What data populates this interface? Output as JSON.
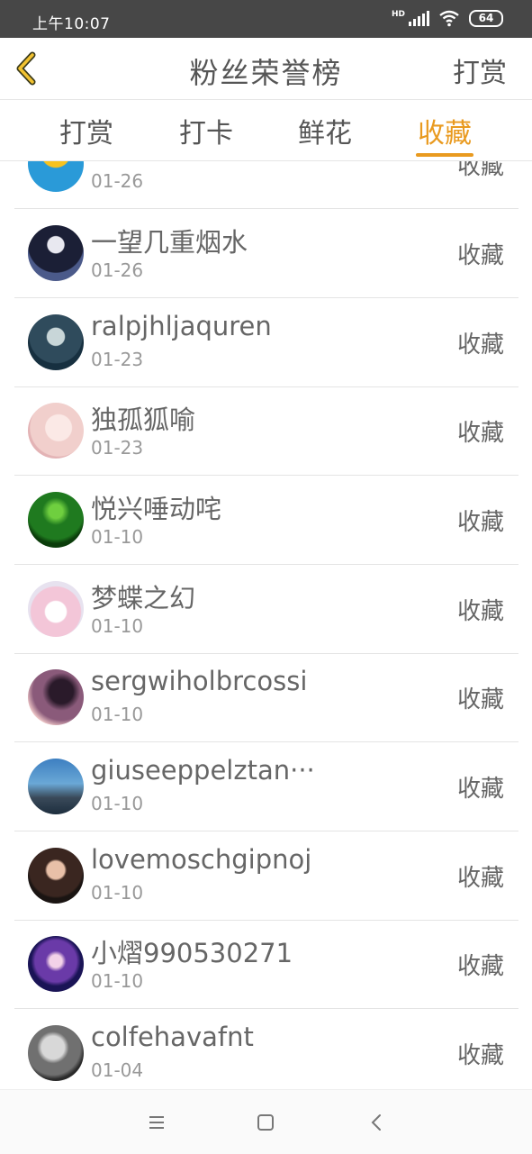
{
  "status_bar": {
    "time": "上午10:07",
    "network": "HD",
    "battery": "64"
  },
  "header": {
    "title": "粉丝荣誉榜",
    "action": "打赏"
  },
  "tabs": [
    {
      "label": "打赏"
    },
    {
      "label": "打卡"
    },
    {
      "label": "鲜花"
    },
    {
      "label": "收藏",
      "active": true
    }
  ],
  "rows": [
    {
      "name": "",
      "date": "01-26",
      "action": "收藏"
    },
    {
      "name": "一望几重烟水",
      "date": "01-26",
      "action": "收藏"
    },
    {
      "name": "ralpjhljaquren",
      "date": "01-23",
      "action": "收藏"
    },
    {
      "name": "独孤狐喻",
      "date": "01-23",
      "action": "收藏"
    },
    {
      "name": "悦兴唾动咤",
      "date": "01-10",
      "action": "收藏"
    },
    {
      "name": "梦蝶之幻",
      "date": "01-10",
      "action": "收藏"
    },
    {
      "name": "sergwiholbrcossi",
      "date": "01-10",
      "action": "收藏"
    },
    {
      "name": "giuseeppelztan···",
      "date": "01-10",
      "action": "收藏"
    },
    {
      "name": "lovemoschgipnoj",
      "date": "01-10",
      "action": "收藏"
    },
    {
      "name": "小熠990530271",
      "date": "01-10",
      "action": "收藏"
    },
    {
      "name": "colfehavafnt",
      "date": "01-04",
      "action": "收藏"
    }
  ],
  "colors": {
    "accent": "#e99a1f",
    "status_bar": "#474747",
    "text": "#555555",
    "subtext": "#999999"
  },
  "icons": [
    "back-arrow-icon",
    "signal-icon",
    "wifi-icon",
    "battery-icon",
    "menu-icon",
    "home-icon",
    "back-icon"
  ]
}
